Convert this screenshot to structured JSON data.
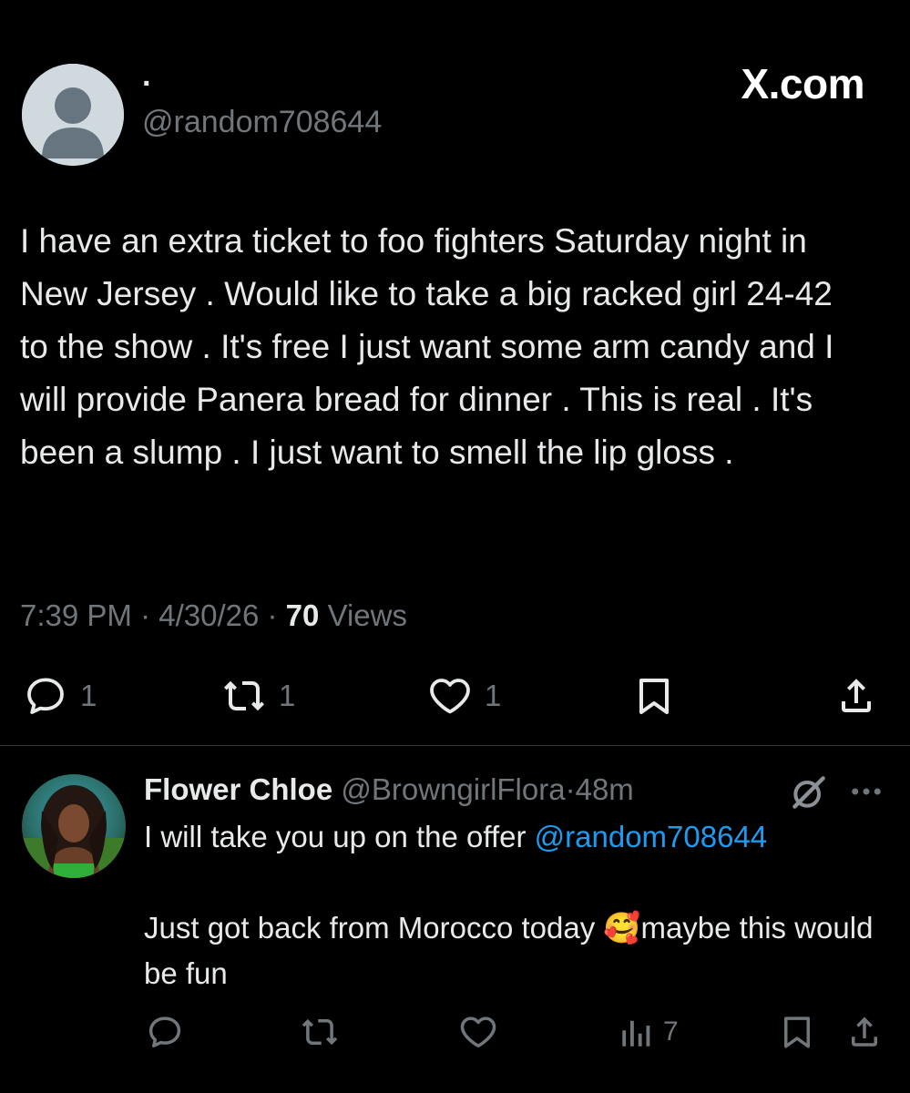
{
  "tweet": {
    "display_name": "·",
    "handle": "@random708644",
    "brand": "X.com",
    "text": "I have an extra ticket to foo fighters Saturday night in New Jersey . Would like to take a big racked girl 24-42 to the show . It's free I just want some arm candy and I will provide Panera bread for dinner . This is real . It's been a slump . I just want to smell the lip gloss .",
    "time": "7:39 PM",
    "date": "4/30/26",
    "views_count": "70",
    "views_label": "Views",
    "separator": " · ",
    "actions": {
      "reply_count": "1",
      "repost_count": "1",
      "like_count": "1"
    }
  },
  "reply": {
    "display_name": "Flower Chloe",
    "handle": "@BrowngirlFlora",
    "age": "48m",
    "separator": "·",
    "text_before_mention": "I will take you up on the offer ",
    "mention": "@random708644",
    "text_line2": "Just got back from Morocco today 🥰maybe this would be fun",
    "actions": {
      "views_count": "7"
    }
  },
  "icons": {
    "avatar_default": "default-avatar-icon",
    "reply": "reply-bubble-icon",
    "repost": "repost-icon",
    "like": "heart-icon",
    "bookmark": "bookmark-icon",
    "share": "share-icon",
    "analytics": "analytics-bars-icon",
    "grok": "grok-icon",
    "more": "more-dots-icon"
  },
  "colors": {
    "background": "#000000",
    "text": "#e7e9ea",
    "muted": "#71767b",
    "link": "#1d9bf0",
    "divider": "#2f3336",
    "avatar_bg": "#cfd9de"
  }
}
